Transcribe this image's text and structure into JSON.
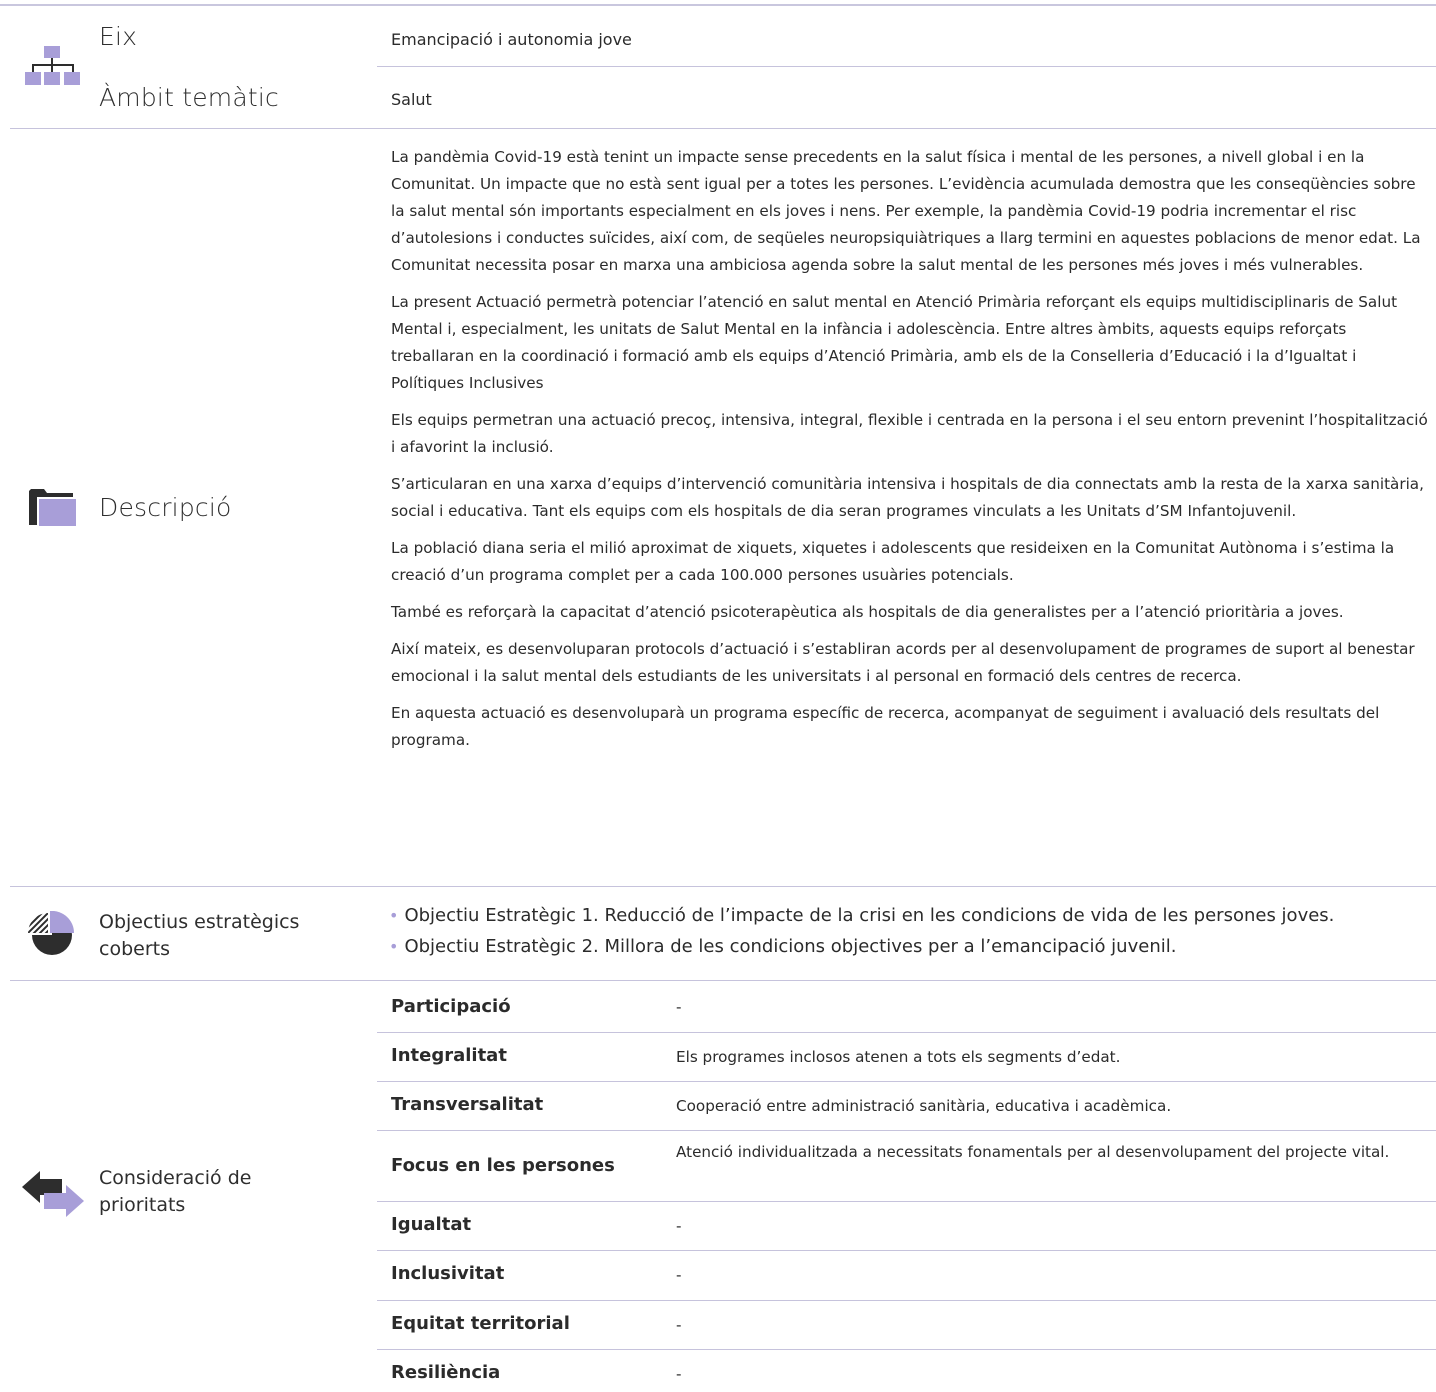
{
  "eix": {
    "label": "Eix",
    "value": "Emancipació i autonomia jove"
  },
  "ambit": {
    "label": "Àmbit temàtic",
    "value": "Salut"
  },
  "descripcio": {
    "label": "Descripció",
    "paragraphs": [
      "La pandèmia Covid-19 està tenint un impacte sense precedents en la salut física i mental de les persones, a nivell global i en la Comunitat. Un impacte que no està sent igual per a totes les persones. L’evidència acumulada demostra que les conseqüències sobre la salut mental són importants especialment en els joves i nens. Per exemple, la pandèmia Covid-19 podria incrementar el risc d’autolesions i conductes suïcides, així com, de seqüeles neuropsiquiàtriques a llarg termini en aquestes poblacions de menor edat. La Comunitat necessita posar en marxa una ambiciosa agenda sobre la salut mental de les persones més joves i més vulnerables.",
      "La present Actuació permetrà potenciar l’atenció en salut mental en Atenció Primària reforçant els equips multidisciplinaris de Salut Mental i, especialment, les unitats de Salut Mental en la infància i adolescència. Entre altres àmbits, aquests equips reforçats treballaran en la coordinació i formació amb els equips d’Atenció Primària, amb els de la Conselleria d’Educació i la d’Igualtat i Polítiques Inclusives",
      "Els equips permetran una actuació precoç, intensiva, integral, flexible i centrada en la persona i el seu entorn prevenint l’hospitalització i afavorint la inclusió.",
      "S’articularan en una xarxa d’equips d’intervenció comunitària intensiva i hospitals de dia connectats amb la resta de la xarxa sanitària, social i educativa. Tant els equips com els hospitals de dia seran programes vinculats a les Unitats d’SM Infantojuvenil.",
      "La població diana seria el milió aproximat de xiquets, xiquetes i adolescents que resideixen en la Comunitat Autònoma i s’estima la creació d’un programa complet per a cada 100.000 persones usuàries potencials.",
      "També es reforçarà la capacitat d’atenció psicoterapèutica als hospitals de dia generalistes per a l’atenció prioritària a joves.",
      "Així mateix, es desenvoluparan protocols d’actuació i s’establiran acords per al desenvolupament de programes de suport al benestar emocional i la salut mental dels estudiants de les universitats i al personal en formació dels centres de recerca.",
      "En aquesta actuació es desenvoluparà un programa específic de recerca, acompanyat de seguiment i avaluació dels resultats del programa."
    ]
  },
  "objectius": {
    "label_line1": "Objectius estratègics",
    "label_line2": "coberts",
    "items": [
      "Objectiu Estratègic 1. Reducció de l’impacte de la crisi en les condicions de vida de les persones joves.",
      "Objectiu Estratègic 2. Millora de les condicions objectives per a l’emancipació juvenil."
    ]
  },
  "prioritats": {
    "label_line1": "Consideració de",
    "label_line2": "prioritats",
    "rows": [
      {
        "name": "Participació",
        "value": "-"
      },
      {
        "name": "Integralitat",
        "value": "Els programes inclosos atenen a tots els segments d’edat."
      },
      {
        "name": "Transversalitat",
        "value": "Cooperació entre administració sanitària, educativa i acadèmica."
      },
      {
        "name": "Focus en les persones",
        "value": "Atenció individualitzada a necessitats fonamentals per al desenvolupament del projecte vital."
      },
      {
        "name": "Igualtat",
        "value": "-"
      },
      {
        "name": "Inclusivitat",
        "value": "-"
      },
      {
        "name": "Equitat territorial",
        "value": "-"
      },
      {
        "name": "Resiliència",
        "value": "-"
      }
    ]
  },
  "colors": {
    "accent": "#a89ed8",
    "dark_icon": "#2d2d2d",
    "rule": "#c6c3dc"
  },
  "icons": [
    "org-chart-icon",
    "folder-icon",
    "pie-chart-icon",
    "arrows-exchange-icon"
  ]
}
